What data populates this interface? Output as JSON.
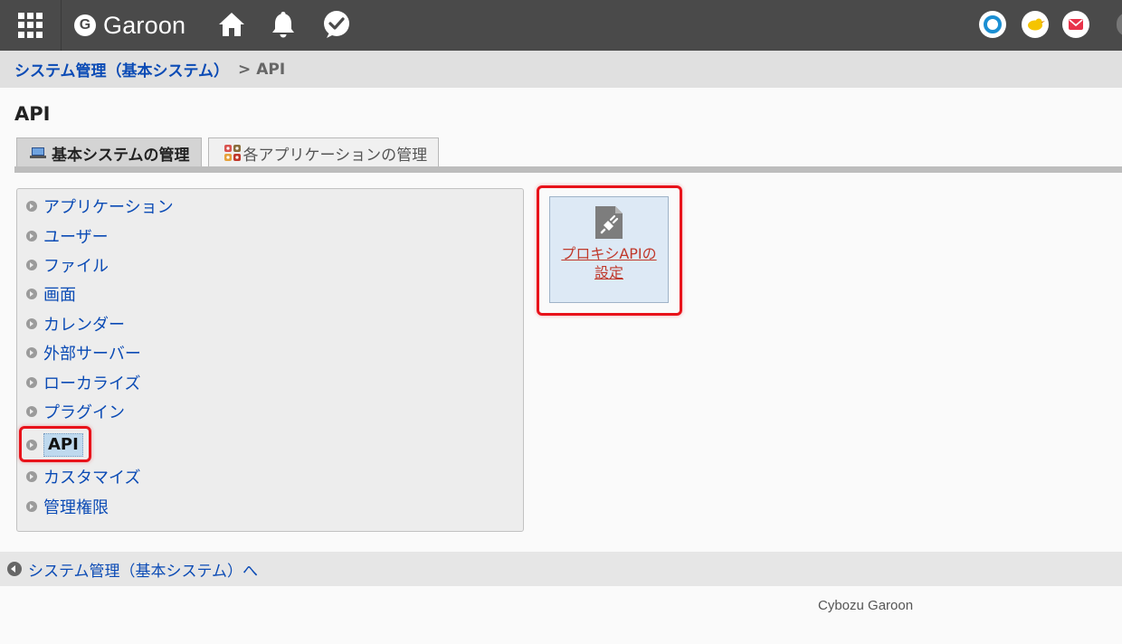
{
  "header": {
    "logo_letter": "G",
    "logo_text": "Garoon",
    "icons": [
      "apps-grid-icon",
      "home-icon",
      "bell-icon",
      "check-bubble-icon",
      "cybozu-circle-icon",
      "bird-icon",
      "mail-icon"
    ],
    "colors": {
      "bar": "#4a4a4a",
      "accent_blue": "#1b8fd3",
      "mail_red": "#e8334a",
      "bird_yellow": "#f5c400"
    }
  },
  "breadcrumb": {
    "parent": "システム管理（基本システム）",
    "separator": ">",
    "current": "API"
  },
  "page_title": "API",
  "tabs": [
    {
      "label": "基本システムの管理",
      "active": true
    },
    {
      "label": "各アプリケーションの管理",
      "active": false
    }
  ],
  "menu": {
    "items": [
      {
        "label": "アプリケーション"
      },
      {
        "label": "ユーザー"
      },
      {
        "label": "ファイル"
      },
      {
        "label": "画面"
      },
      {
        "label": "カレンダー"
      },
      {
        "label": "外部サーバー"
      },
      {
        "label": "ローカライズ"
      },
      {
        "label": "プラグイン"
      },
      {
        "label": "API",
        "selected": true
      },
      {
        "label": "カスタマイズ"
      },
      {
        "label": "管理権限"
      }
    ]
  },
  "card": {
    "link_line1": "プロキシAPIの",
    "link_line2": "設定",
    "icon": "plug-document-icon"
  },
  "back_link": "システム管理（基本システム）へ",
  "footer": "Cybozu Garoon",
  "highlight_color": "#e8121a"
}
